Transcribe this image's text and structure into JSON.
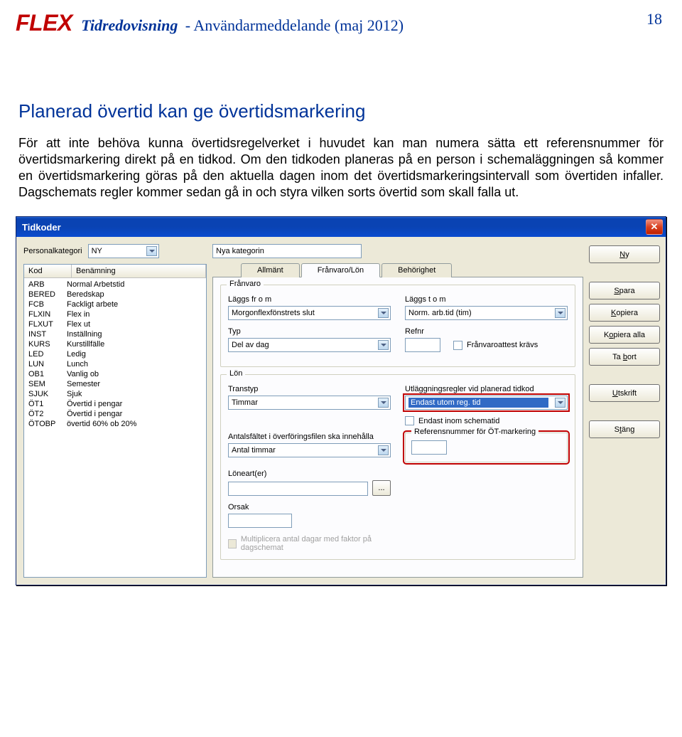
{
  "header": {
    "logo": "FLEX",
    "title": "Tidredovisning",
    "subtitle": "- Användarmeddelande (maj 2012)",
    "page_number": "18"
  },
  "document": {
    "section_title": "Planerad övertid kan ge övertidsmarkering",
    "body_text": "För att inte behöva kunna övertidsregelverket i huvudet kan man numera sätta ett referensnummer för övertidsmarkering direkt på en tidkod. Om den tidkoden planeras på en person i schemaläggningen så kommer en övertidsmarkering göras på den aktuella dagen inom det övertidsmarkeringsintervall som övertiden infaller. Dagschemats regler kommer sedan gå in och styra vilken sorts övertid som skall falla ut."
  },
  "dialog": {
    "title": "Tidkoder",
    "personalkategori_label": "Personalkategori",
    "personalkategori_value": "NY",
    "category_name": "Nya kategorin",
    "list": {
      "headers": {
        "kod": "Kod",
        "ben": "Benämning"
      },
      "rows": [
        {
          "kod": "ARB",
          "ben": "Normal Arbetstid"
        },
        {
          "kod": "BERED",
          "ben": "Beredskap"
        },
        {
          "kod": "FCB",
          "ben": "Fackligt arbete"
        },
        {
          "kod": "FLXIN",
          "ben": "Flex in"
        },
        {
          "kod": "FLXUT",
          "ben": "Flex ut"
        },
        {
          "kod": "INST",
          "ben": "Inställning"
        },
        {
          "kod": "KURS",
          "ben": "Kurstillfälle"
        },
        {
          "kod": "LED",
          "ben": "Ledig"
        },
        {
          "kod": "LUN",
          "ben": "Lunch"
        },
        {
          "kod": "OB1",
          "ben": "Vanlig ob"
        },
        {
          "kod": "SEM",
          "ben": "Semester"
        },
        {
          "kod": "SJUK",
          "ben": "Sjuk"
        },
        {
          "kod": "ÖT1",
          "ben": "Övertid i pengar"
        },
        {
          "kod": "ÖT2",
          "ben": "Övertid i pengar"
        },
        {
          "kod": "ÖTOBP",
          "ben": "övertid 60% ob 20%"
        }
      ]
    },
    "tabs": {
      "allmant": "Allmänt",
      "franvaro_lon": "Frånvaro/Lön",
      "behorighet": "Behörighet"
    },
    "franvaro_group": {
      "legend": "Frånvaro",
      "laggs_from_label": "Läggs fr o m",
      "laggs_from_value": "Morgonflexfönstrets slut",
      "laggs_tom_label": "Läggs t o m",
      "laggs_tom_value": "Norm. arb.tid (tim)",
      "typ_label": "Typ",
      "typ_value": "Del av dag",
      "refnr_label": "Refnr",
      "refnr_value": "",
      "attest_label": "Frånvaroattest krävs"
    },
    "lon_group": {
      "legend": "Lön",
      "transtyp_label": "Transtyp",
      "transtyp_value": "Timmar",
      "antals_label": "Antalsfältet i överföringsfilen ska innehålla",
      "antals_value": "Antal timmar",
      "lonearter_label": "Löneart(er)",
      "lonearter_value": "",
      "lonearter_btn": "...",
      "orsak_label": "Orsak",
      "orsak_value": "",
      "multip_label": "Multiplicera antal dagar med faktor på dagschemat",
      "utlagg_label": "Utläggningsregler vid planerad tidkod",
      "utlagg_value": "Endast utom reg. tid",
      "endast_schematid_label": "Endast inom schematid",
      "refnr_ot_label": "Referensnummer för ÖT-markering",
      "refnr_ot_value": ""
    },
    "buttons": {
      "ny": "Ny",
      "spara": "Spara",
      "kopiera": "Kopiera",
      "kopiera_alla": "Kopiera alla",
      "ta_bort": "Ta bort",
      "utskrift": "Utskrift",
      "stang": "Stäng"
    }
  }
}
